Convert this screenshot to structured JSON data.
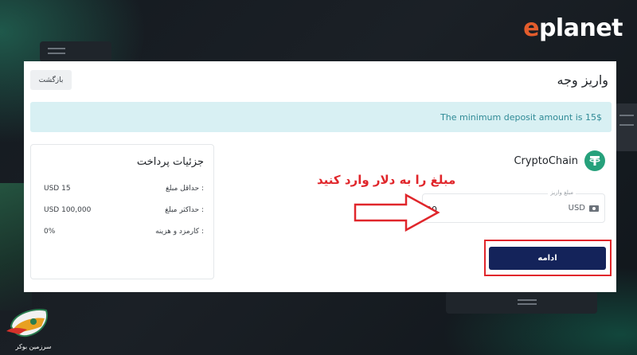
{
  "brand": {
    "name_accent": "e",
    "name_rest": "planet"
  },
  "watermark": {
    "text": "سرزمین بوکر"
  },
  "page": {
    "title": "واریز وجه",
    "back_label": "بازگشت"
  },
  "alert": {
    "message": "The minimum deposit amount is 15$"
  },
  "details": {
    "title": "جزئیات پرداخت",
    "rows": [
      {
        "label": "حداقل مبلغ :",
        "value": "USD 15"
      },
      {
        "label": "حداکثر مبلغ :",
        "value": "USD 100,000"
      },
      {
        "label": "کارمزد و هزینه :",
        "value": "0%"
      }
    ]
  },
  "network": {
    "name": "CryptoChain",
    "icon": "tether-icon"
  },
  "amount": {
    "label": "مبلغ واریز",
    "value": "20",
    "currency": "USD"
  },
  "continue_label": "ادامه",
  "annotation": {
    "text": "مبلغ را به دلار وارد کنید"
  },
  "colors": {
    "accent_button": "#14235a",
    "alert_bg": "#d8f0f3",
    "annotation_red": "#e0262b",
    "tether_green": "#26a17b",
    "brand_orange": "#e25c2c"
  }
}
